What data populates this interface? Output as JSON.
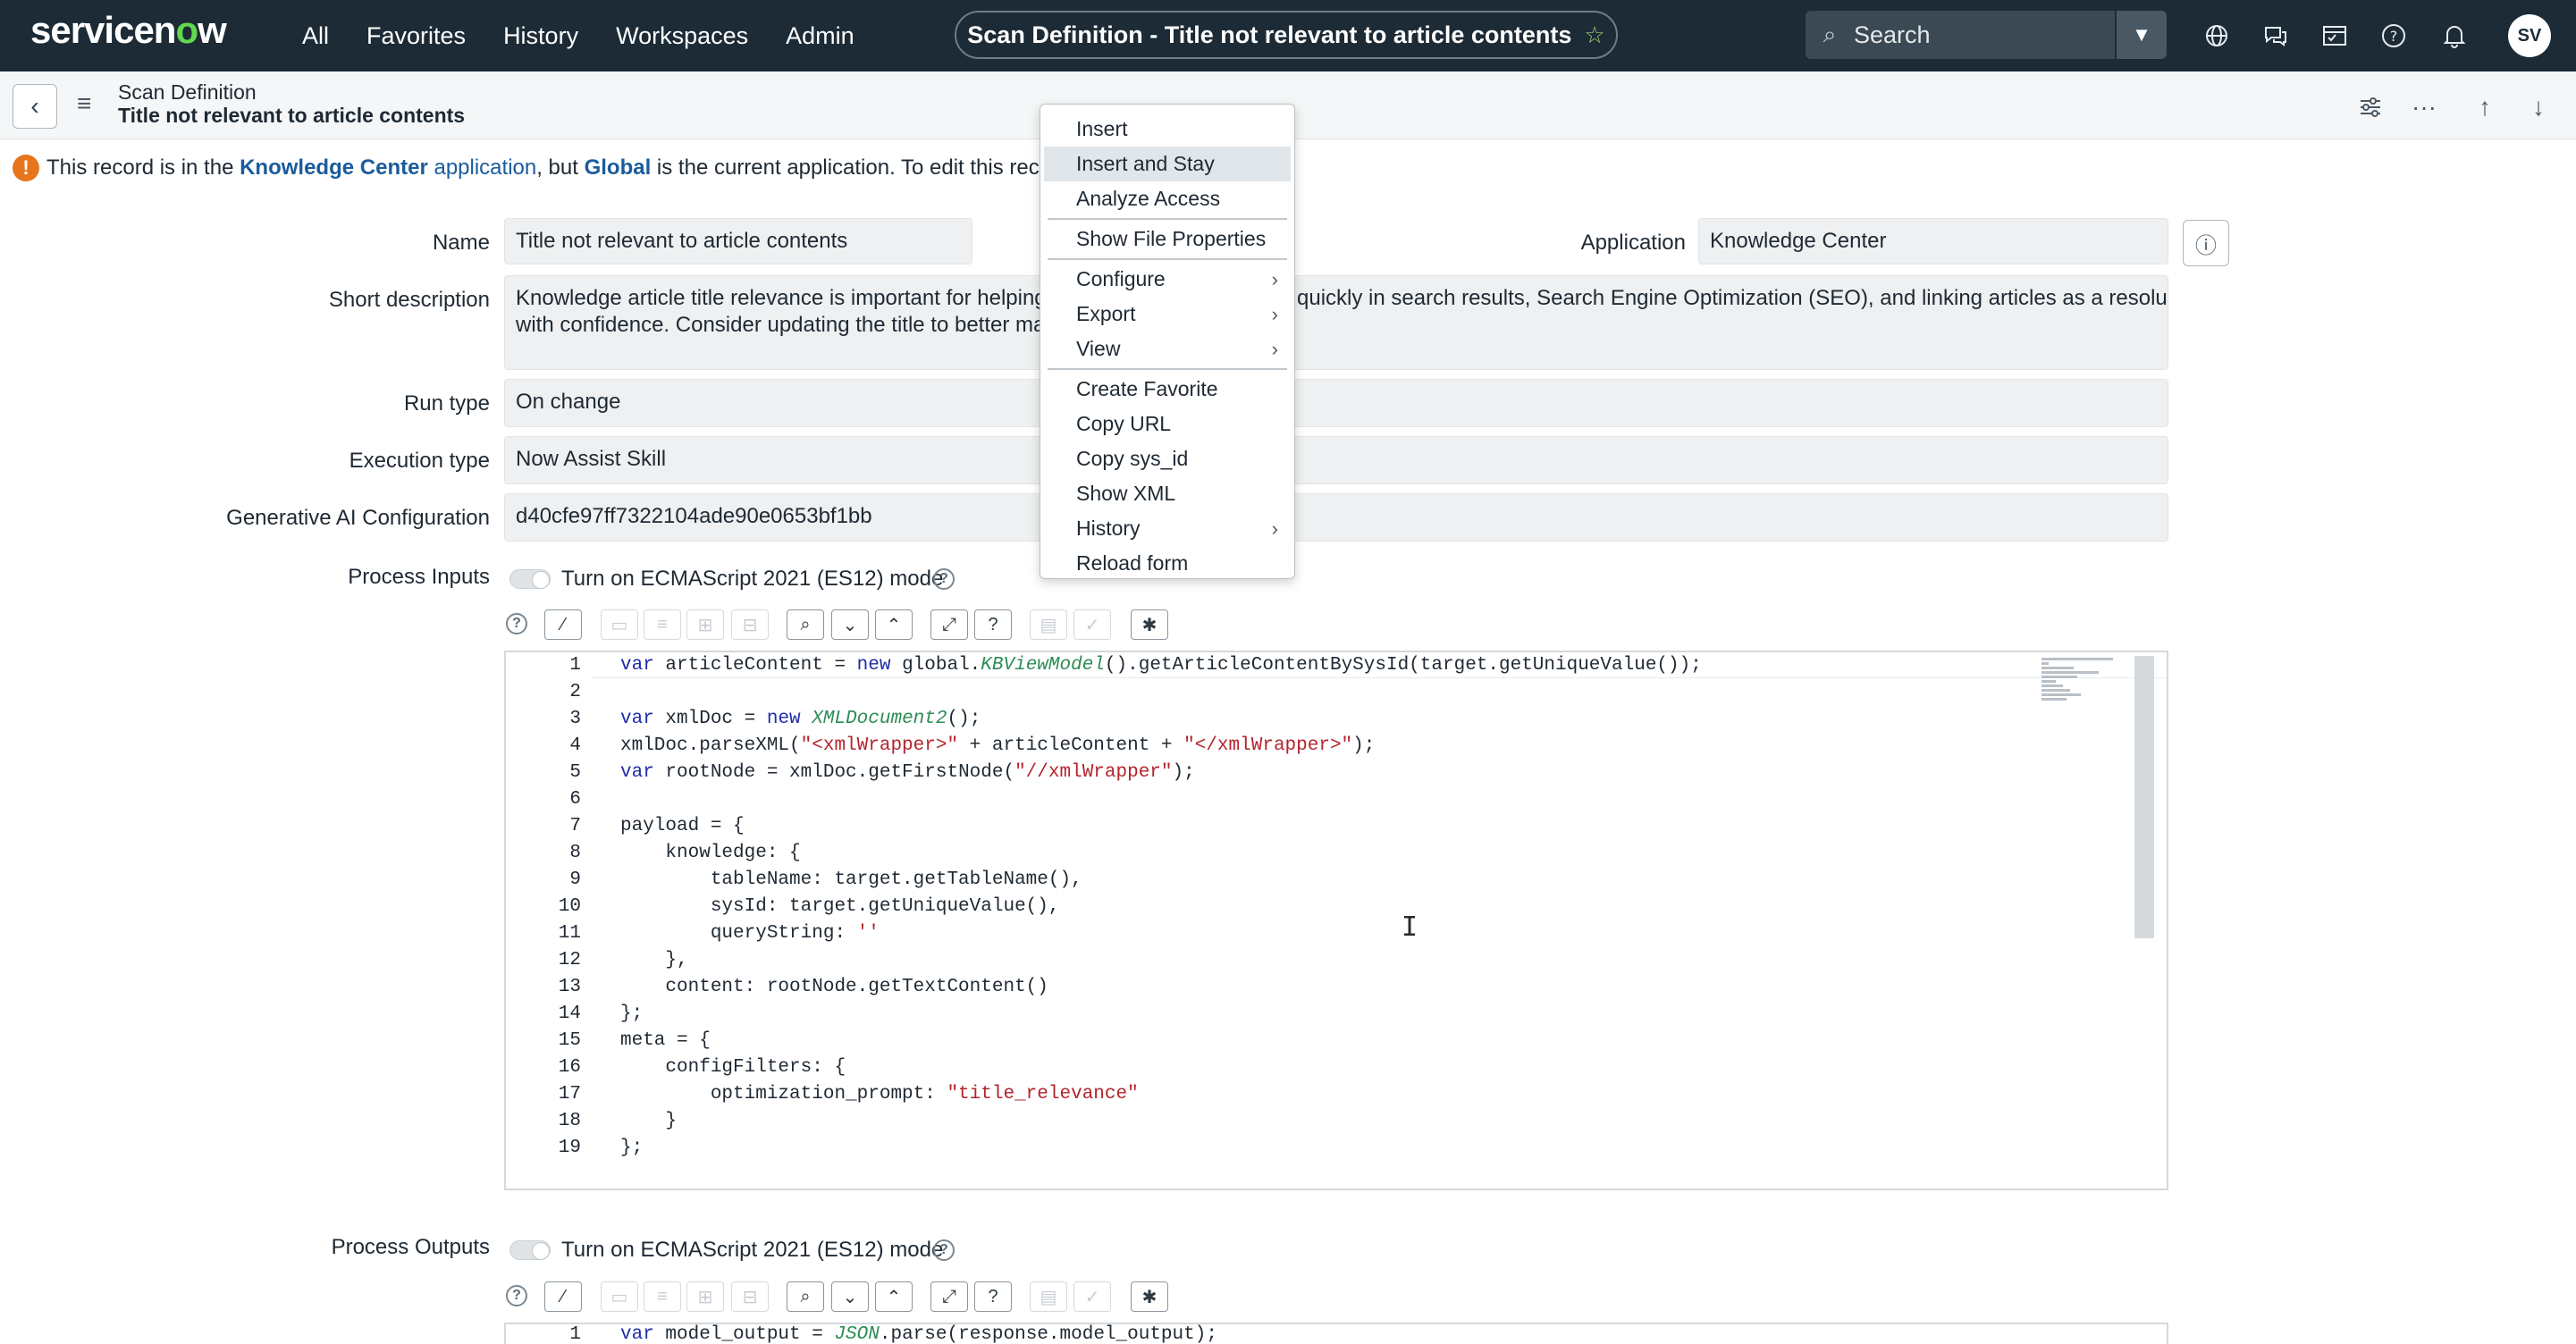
{
  "nav": {
    "logo": "servicenow",
    "links": [
      "All",
      "Favorites",
      "History",
      "Workspaces",
      "Admin"
    ],
    "title": "Scan Definition - Title not relevant to article contents",
    "search_placeholder": "Search",
    "avatar_initials": "SV"
  },
  "form_header": {
    "table": "Scan Definition",
    "record": "Title not relevant to article contents"
  },
  "banner": {
    "pre": "This record is in the ",
    "app_link": "Knowledge Center",
    "app_word": "application",
    "mid": ", but ",
    "current_app": "Global",
    "post": " is the current application. To edit this record cl"
  },
  "fields": {
    "name_label": "Name",
    "name_value": "Title not relevant to article contents",
    "application_label": "Application",
    "application_value": "Knowledge Center",
    "short_desc_label": "Short description",
    "short_desc_line1_a": "Knowledge article title relevance is important for helping",
    "short_desc_line1_b": "quickly in search results, Search Engine Optimization (SEO), and linking articles as a resolution",
    "short_desc_line2": "with confidence. Consider updating the title to better mat",
    "run_type_label": "Run type",
    "run_type_value": "On change",
    "exec_type_label": "Execution type",
    "exec_type_value": "Now Assist Skill",
    "genai_label": "Generative AI Configuration",
    "genai_value": "d40cfe97ff7322104ade90e0653bf1bb",
    "process_inputs_label": "Process Inputs",
    "process_outputs_label": "Process Outputs",
    "ecma_label": "Turn on ECMAScript 2021 (ES12) mode"
  },
  "context_menu": {
    "items": [
      "Insert",
      "Insert and Stay",
      "Analyze Access",
      "Show File Properties",
      "Configure",
      "Export",
      "View",
      "Create Favorite",
      "Copy URL",
      "Copy sys_id",
      "Show XML",
      "History",
      "Reload form"
    ],
    "highlighted": "Insert and Stay"
  },
  "code": {
    "line_numbers": [
      "1",
      "2",
      "3",
      "4",
      "5",
      "6",
      "7",
      "8",
      "9",
      "10",
      "11",
      "12",
      "13",
      "14",
      "15",
      "16",
      "17",
      "18",
      "19"
    ],
    "l1_a": "var",
    "l1_b": " articleContent = ",
    "l1_c": "new",
    "l1_d": " global.",
    "l1_e": "KBViewModel",
    "l1_f": "().getArticleContentBySysId(target.getUniqueValue());",
    "l3_a": "var",
    "l3_b": " xmlDoc = ",
    "l3_c": "new",
    "l3_d": " ",
    "l3_e": "XMLDocument2",
    "l3_f": "();",
    "l4_a": "xmlDoc.parseXML(",
    "l4_b": "\"<xmlWrapper>\"",
    "l4_c": " + articleContent + ",
    "l4_d": "\"</xmlWrapper>\"",
    "l4_e": ");",
    "l5_a": "var",
    "l5_b": " rootNode = xmlDoc.getFirstNode(",
    "l5_c": "\"//xmlWrapper\"",
    "l5_d": ");",
    "l7": "payload = {",
    "l8": "    knowledge: {",
    "l9": "        tableName: target.getTableName(),",
    "l10": "        sysId: target.getUniqueValue(),",
    "l11_a": "        queryString: ",
    "l11_b": "''",
    "l12": "    },",
    "l13": "    content: rootNode.getTextContent()",
    "l14": "};",
    "l15": "meta = {",
    "l16": "    configFilters: {",
    "l17_a": "        optimization_prompt: ",
    "l17_b": "\"title_relevance\"",
    "l18": "    }",
    "l19": "};",
    "out_num": "1",
    "out_a": "var",
    "out_b": " model_output = ",
    "out_c": "JSON",
    "out_d": ".parse(response.model_output);"
  }
}
